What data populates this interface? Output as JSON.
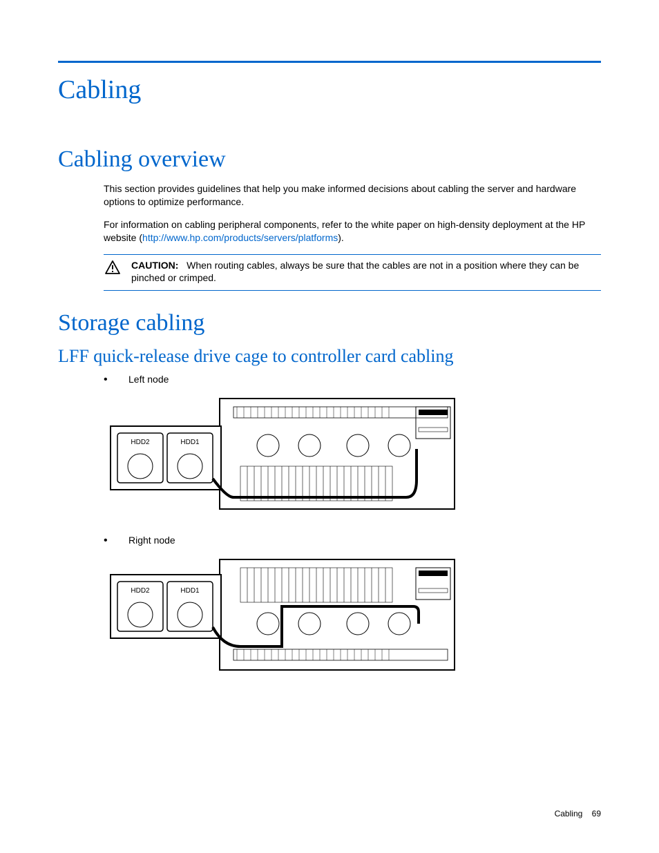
{
  "chapter_title": "Cabling",
  "section1": {
    "title": "Cabling overview",
    "para1": "This section provides guidelines that help you make informed decisions about cabling the server and hardware options to optimize performance.",
    "para2_pre": "For information on cabling peripheral components, refer to the white paper on high-density deployment at the HP website (",
    "para2_link": "http://www.hp.com/products/servers/platforms",
    "para2_post": ").",
    "caution_label": "CAUTION:",
    "caution_text": "When routing cables, always be sure that the cables are not in a position where they can be pinched or crimped."
  },
  "section2": {
    "title": "Storage cabling",
    "subsection_title": "LFF quick-release drive cage to controller card cabling",
    "bullets": [
      "Left node",
      "Right node"
    ]
  },
  "diagram_labels": {
    "hdd1": "HDD1",
    "hdd2": "HDD2"
  },
  "footer": {
    "section": "Cabling",
    "page": "69"
  }
}
